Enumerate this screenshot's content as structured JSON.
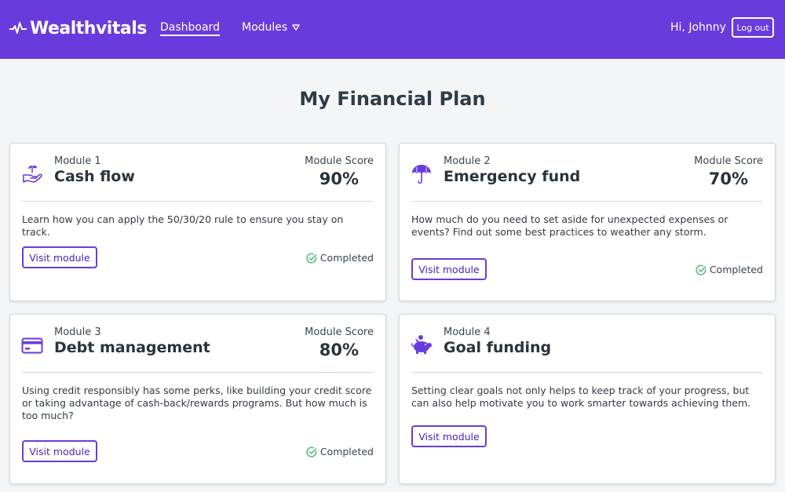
{
  "header": {
    "brand": "Wealthvitals",
    "nav": {
      "dashboard": "Dashboard",
      "modules": "Modules"
    },
    "greeting": "Hi, Johnny",
    "logout": "Log out"
  },
  "page": {
    "title": "My Financial Plan"
  },
  "modules": [
    {
      "number": "Module 1",
      "title": "Cash flow",
      "score_label": "Module Score",
      "score": "90%",
      "description": "Learn how you can apply the 50/30/20 rule to ensure you stay on track.",
      "button": "Visit module",
      "status": "Completed",
      "icon": "hand-sprout-icon"
    },
    {
      "number": "Module 2",
      "title": "Emergency fund",
      "score_label": "Module Score",
      "score": "70%",
      "description": "How much do you need to set aside for unexpected expenses or events? Find out some best practices to weather any storm.",
      "button": "Visit module",
      "status": "Completed",
      "icon": "umbrella-icon"
    },
    {
      "number": "Module 3",
      "title": "Debt management",
      "score_label": "Module Score",
      "score": "80%",
      "description": "Using credit responsibly has some perks, like building your credit score or taking advantage of cash-back/rewards programs. But how much is too much?",
      "button": "Visit module",
      "status": "Completed",
      "icon": "credit-card-icon"
    },
    {
      "number": "Module 4",
      "title": "Goal funding",
      "description": "Setting clear goals not only helps to keep track of your progress, but can also help motivate you to work smarter towards achieving them.",
      "button": "Visit module",
      "icon": "piggy-bank-icon"
    }
  ],
  "colors": {
    "brand": "#6a3bdc",
    "completed": "#3cb371"
  }
}
